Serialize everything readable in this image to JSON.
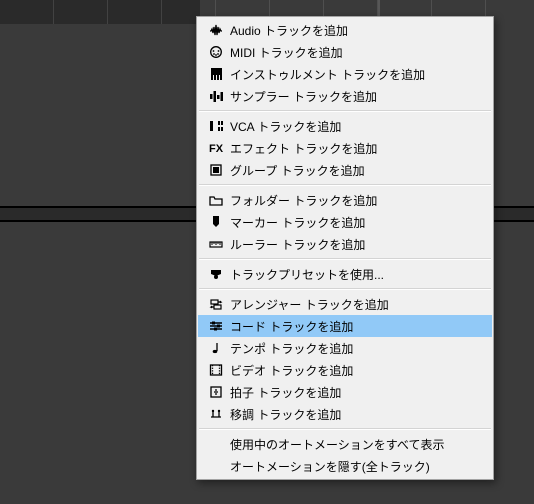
{
  "menu": {
    "items": [
      {
        "label": "Audio トラックを追加",
        "icon": "audio"
      },
      {
        "label": "MIDI トラックを追加",
        "icon": "midi"
      },
      {
        "label": "インストゥルメント トラックを追加",
        "icon": "instrument"
      },
      {
        "label": "サンプラー トラックを追加",
        "icon": "sampler"
      },
      {
        "sep": true
      },
      {
        "label": "VCA トラックを追加",
        "icon": "vca"
      },
      {
        "label": "エフェクト トラックを追加",
        "icon": "fx"
      },
      {
        "label": "グループ トラックを追加",
        "icon": "group"
      },
      {
        "sep": true
      },
      {
        "label": "フォルダー トラックを追加",
        "icon": "folder"
      },
      {
        "label": "マーカー トラックを追加",
        "icon": "marker"
      },
      {
        "label": "ルーラー トラックを追加",
        "icon": "ruler"
      },
      {
        "sep": true
      },
      {
        "label": "トラックプリセットを使用...",
        "icon": "preset"
      },
      {
        "sep": true
      },
      {
        "label": "アレンジャー トラックを追加",
        "icon": "arranger"
      },
      {
        "label": "コード トラックを追加",
        "icon": "chord",
        "highlight": true
      },
      {
        "label": "テンポ トラックを追加",
        "icon": "tempo"
      },
      {
        "label": "ビデオ トラックを追加",
        "icon": "video"
      },
      {
        "label": "拍子 トラックを追加",
        "icon": "signature"
      },
      {
        "label": "移調 トラックを追加",
        "icon": "transpose"
      },
      {
        "sep": true
      },
      {
        "label": "使用中のオートメーションをすべて表示",
        "indent": true
      },
      {
        "label": "オートメーションを隠す(全トラック)",
        "indent": true
      }
    ]
  }
}
